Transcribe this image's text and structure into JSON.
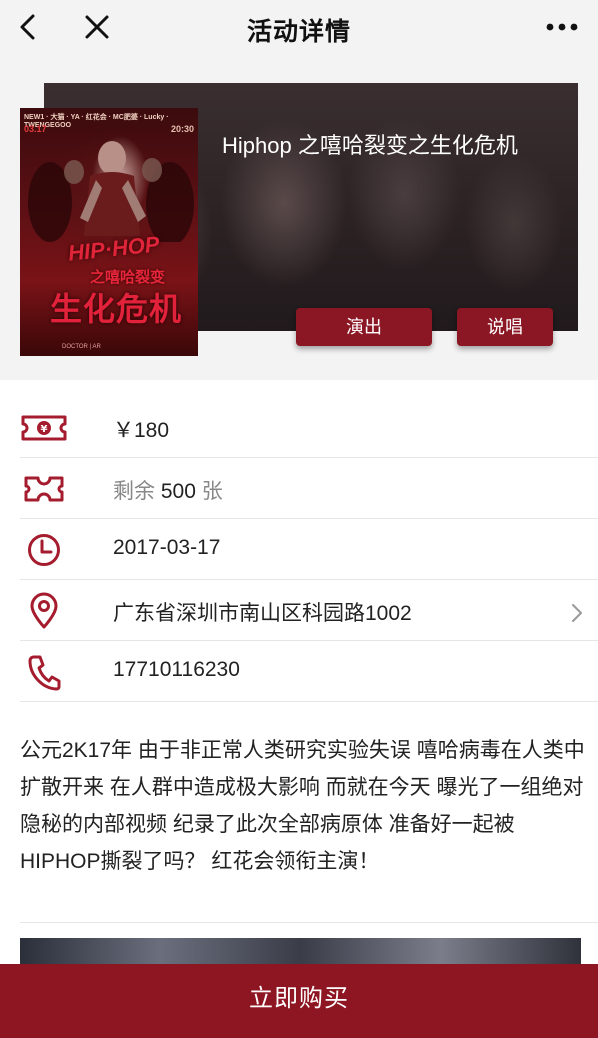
{
  "nav": {
    "title": "活动详情"
  },
  "event": {
    "title": "Hiphop 之嘻哈裂变之生化危机",
    "tags": [
      "演出",
      "说唱"
    ],
    "poster": {
      "top_text": "NEW1 · 大猫 · YA · 红花会 · MC肥婆 · Lucky · TWENGEGOO",
      "date_left": "03.17",
      "time_right": "20:30",
      "title_line1": "HIP·HOP",
      "title_line2": "之嘻哈裂变",
      "title_line3": "生化危机",
      "footer": "DOCTOR | AR"
    }
  },
  "info": {
    "price": "￥180",
    "stock_prefix": "剩余",
    "stock_count": "500",
    "stock_suffix": "张",
    "date": "2017-03-17",
    "address": "广东省深圳市南山区科园路1002",
    "phone": "17710116230"
  },
  "description": "公元2K17年 由于非正常人类研究实验失误 嘻哈病毒在人类中扩散开来 在人群中造成极大影响 而就在今天 曝光了一组绝对隐秘的内部视频 纪录了此次全部病原体 准备好一起被HIPHOP撕裂了吗？ 红花会领衔主演！",
  "buy": {
    "label": "立即购买"
  },
  "colors": {
    "accent": "#8e1522",
    "icon": "#a51c2e"
  }
}
